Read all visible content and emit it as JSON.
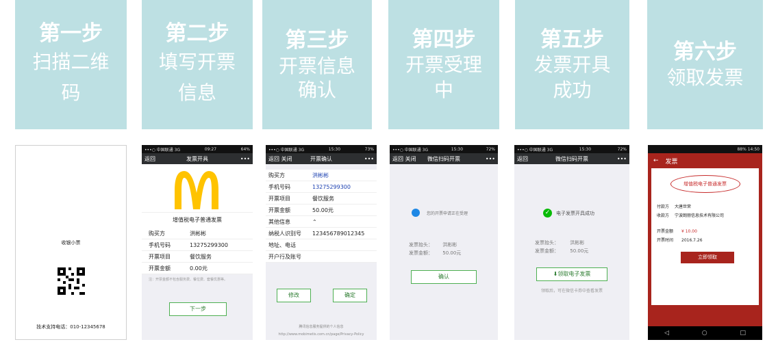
{
  "steps": [
    {
      "title": "第一步",
      "body": "扫描二维\n码"
    },
    {
      "title": "第二步",
      "body": "填写开票\n信息"
    },
    {
      "title": "第三步",
      "body": "开票信息\n确认"
    },
    {
      "title": "第四步",
      "body": "开票受理\n中"
    },
    {
      "title": "第五步",
      "body": "发票开具\n成功"
    },
    {
      "title": "第六步",
      "body": "领取发票"
    }
  ],
  "shot1": {
    "label": "收银小票",
    "support": "技术支持电话：010-12345678"
  },
  "shot2": {
    "status_left": "•••○ 中国联通 3G",
    "time": "09:27",
    "battery": "64%",
    "back": "返回",
    "title": "发票开具",
    "more": "•••",
    "invoice_title": "增值税电子普通发票",
    "fields": [
      [
        "购买方",
        "洪彬彬"
      ],
      [
        "手机号码",
        "13275299300"
      ],
      [
        "开票项目",
        "餐饮服务"
      ],
      [
        "开票金额",
        "0.00元"
      ]
    ],
    "note": "注：开票金额不包含服务费、餐位费、套餐优惠等。",
    "next": "下一步"
  },
  "shot3": {
    "status_left": "•••○ 中国联通 3G",
    "time": "15:30",
    "battery": "73%",
    "back": "返回  关闭",
    "title": "开票确认",
    "more": "•••",
    "fields": [
      [
        "购买方",
        "洪彬彬"
      ],
      [
        "手机号码",
        "13275299300"
      ],
      [
        "开票项目",
        "餐饮服务"
      ],
      [
        "开票金额",
        "50.00元"
      ],
      [
        "其他信息",
        "⌃"
      ],
      [
        "纳税人识别号",
        "123456789012345"
      ],
      [
        "地址、电话",
        ""
      ],
      [
        "开户行及账号",
        ""
      ]
    ],
    "modify": "修改",
    "confirm": "确定",
    "footer1": "腾讯信息服务提供的个人信息",
    "footer2": "http://www.mobimetis.com.cn/page/Privacy-Policy"
  },
  "shot4": {
    "status_left": "•••○ 中国联通 3G",
    "time": "15:30",
    "battery": "72%",
    "back": "返回  关闭",
    "title": "微信扫码开票",
    "more": "•••",
    "msg": "您的开票申请正在受理",
    "h_label": "发票抬头：",
    "h_val": "洪彬彬",
    "a_label": "发票金额：",
    "a_val": "50.00元",
    "confirm": "确认"
  },
  "shot5": {
    "status_left": "•••○ 中国联通 3G",
    "time": "15:30",
    "battery": "72%",
    "back": "返回",
    "title": "微信扫码开票",
    "more": "•••",
    "msg": "电子发票开具成功",
    "h_label": "发票抬头：",
    "h_val": "洪彬彬",
    "a_label": "发票金额：",
    "a_val": "50.00元",
    "get": "领取电子发票",
    "tip": "领取后，可在微信卡券中查看发票"
  },
  "shot6": {
    "status_right": "88% 14:50",
    "back": "←",
    "title": "发票",
    "invoice_title": "增值税电子普通发票",
    "payer_label": "付款方",
    "payer": "大唐世荣",
    "payee_label": "收款方",
    "payee": "宁波朗丽信息技术有限公司",
    "amt_label": "开票金额",
    "amt": "¥ 10.00",
    "date_label": "开票时间",
    "date": "2016.7.26",
    "btn": "立即领取"
  },
  "colors": {
    "step_bg": "#bde0e3",
    "mc_yellow": "#ffc300",
    "wx_green": "#09bb07",
    "red": "#a8241d"
  }
}
